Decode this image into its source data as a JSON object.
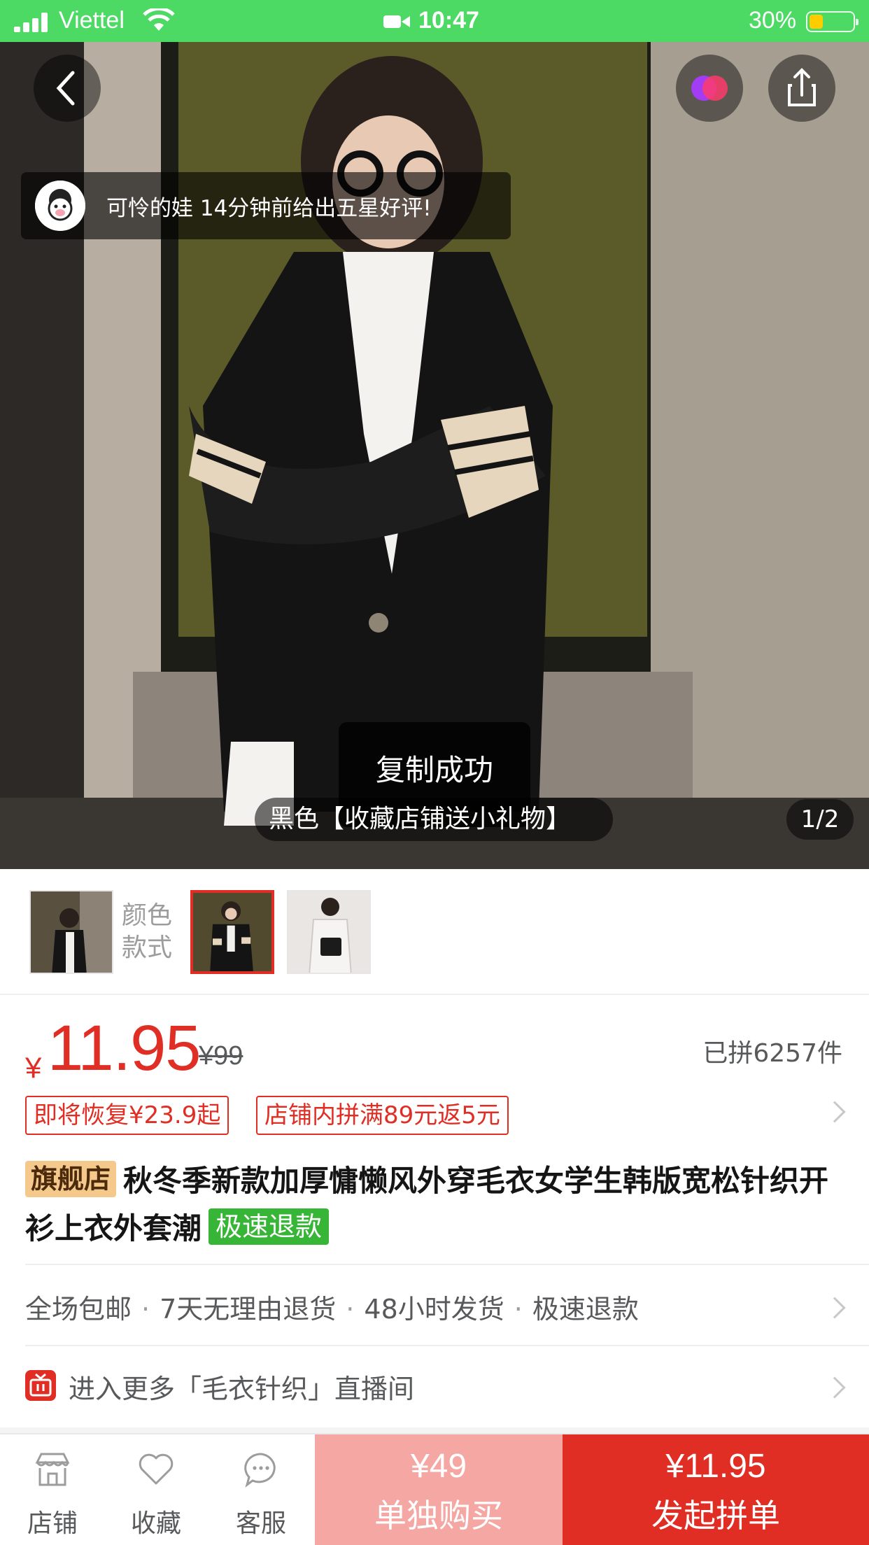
{
  "status_bar": {
    "carrier": "Viettel",
    "time": "10:47",
    "battery": "30%",
    "battery_level": 0.3
  },
  "hero": {
    "review_toast": "可怜的娃 14分钟前给出五星好评!",
    "sku_label": "黑色【收藏店铺送小礼物】",
    "page_indicator": "1/2",
    "copy_toast": "复制成功"
  },
  "thumbnails": {
    "caption": "颜色款式",
    "items": [
      "thumb-1",
      "thumb-2-selected",
      "thumb-3"
    ]
  },
  "price": {
    "currency": "¥",
    "current": "11.95",
    "original": "¥99",
    "sold": "已拼6257件"
  },
  "tags": {
    "restore": "即将恢复¥23.9起",
    "store_promo": "店铺内拼满89元返5元"
  },
  "product": {
    "store_badge": "旗舰店",
    "title": "秋冬季新款加厚慵懒风外穿毛衣女学生韩版宽松针织开衫上衣外套潮",
    "refund_badge": "极速退款"
  },
  "services": [
    "全场包邮",
    "7天无理由退货",
    "48小时发货",
    "极速退款"
  ],
  "live": {
    "text": "进入更多「毛衣针织」直播间"
  },
  "bottom_bar": {
    "store": "店铺",
    "favorite": "收藏",
    "service": "客服",
    "solo_price": "¥49",
    "solo_label": "单独购买",
    "group_price": "¥11.95",
    "group_label": "发起拼单"
  },
  "colors": {
    "status_green": "#4cd964",
    "accent_red": "#e02e24",
    "solo_pink": "#f4a7a3",
    "refund_green": "#37b536",
    "store_gold": "#f4c98b"
  }
}
